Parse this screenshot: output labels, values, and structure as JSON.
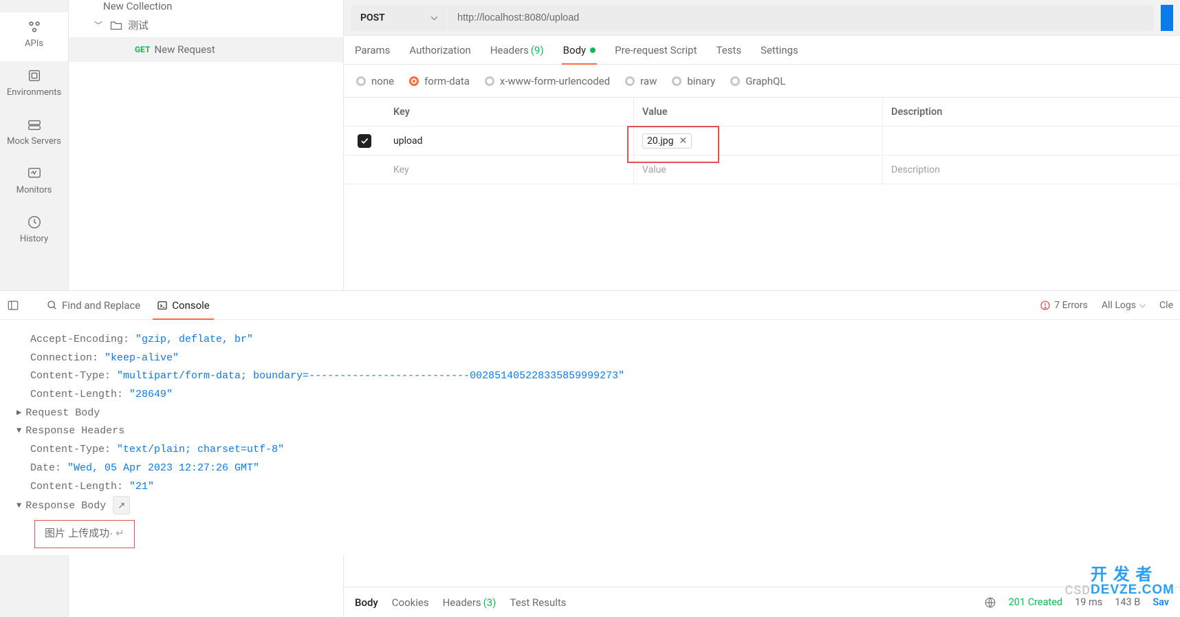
{
  "nav": {
    "items": [
      {
        "label": "APIs"
      },
      {
        "label": "Environments"
      },
      {
        "label": "Mock Servers"
      },
      {
        "label": "Monitors"
      },
      {
        "label": "History"
      }
    ]
  },
  "collections": {
    "top": "New Collection",
    "folder": "测试",
    "request": {
      "method": "GET",
      "name": "New Request"
    }
  },
  "request": {
    "method": "POST",
    "url": "http://localhost:8080/upload",
    "tabs": {
      "params": "Params",
      "auth": "Authorization",
      "headers": "Headers",
      "headers_count": "(9)",
      "body": "Body",
      "prereq": "Pre-request Script",
      "tests": "Tests",
      "settings": "Settings"
    },
    "body_types": {
      "none": "none",
      "form_data": "form-data",
      "xwww": "x-www-form-urlencoded",
      "raw": "raw",
      "binary": "binary",
      "graphql": "GraphQL"
    },
    "form_table": {
      "headers": {
        "key": "Key",
        "value": "Value",
        "desc": "Description"
      },
      "rows": [
        {
          "checked": true,
          "key": "upload",
          "value": "20.jpg",
          "desc": ""
        }
      ],
      "placeholder": {
        "key": "Key",
        "value": "Value",
        "desc": "Description"
      }
    }
  },
  "response": {
    "tabs": {
      "body": "Body",
      "cookies": "Cookies",
      "headers": "Headers",
      "headers_count": "(3)",
      "test_results": "Test Results"
    },
    "status": "201 Created",
    "time": "19 ms",
    "size": "143 B",
    "save": "Sav"
  },
  "footer": {
    "find_replace": "Find and Replace",
    "console": "Console",
    "errors": "7 Errors",
    "all_logs": "All Logs",
    "clear": "Cle"
  },
  "console": {
    "accept_encoding_k": "Accept-Encoding: ",
    "accept_encoding_v": "\"gzip, deflate, br\"",
    "connection_k": "Connection: ",
    "connection_v": "\"keep-alive\"",
    "content_type_k": "Content-Type: ",
    "content_type_v": "\"multipart/form-data; boundary=--------------------------002851405228335859999273\"",
    "content_length_k": "Content-Length: ",
    "content_length_v": "\"28649\"",
    "request_body": "Request Body",
    "response_headers": "Response Headers",
    "resp_ct_k": "Content-Type: ",
    "resp_ct_v": "\"text/plain; charset=utf-8\"",
    "date_k": "Date: ",
    "date_v": "\"Wed, 05 Apr 2023 12:27:26 GMT\"",
    "resp_cl_k": "Content-Length: ",
    "resp_cl_v": "\"21\"",
    "response_body": "Response Body",
    "response_text": "图片  上传成功·"
  },
  "watermark": {
    "csd": "CSD",
    "l1": "开 发 者",
    "l2": "DEVZE.COM"
  }
}
